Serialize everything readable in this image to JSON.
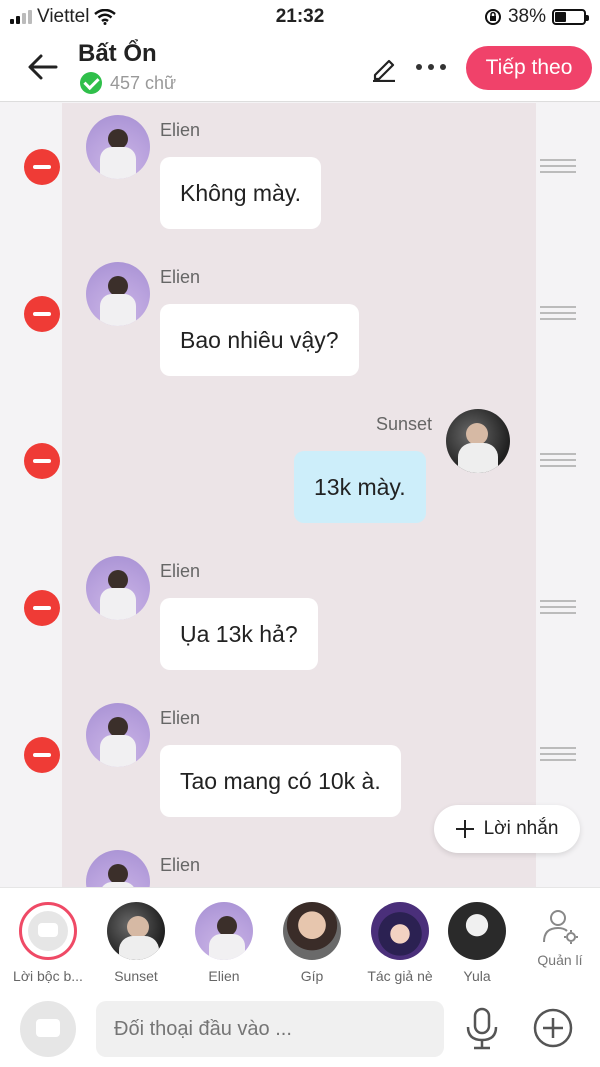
{
  "status": {
    "carrier": "Viettel",
    "time": "21:32",
    "battery": "38%",
    "battery_level": 0.38
  },
  "header": {
    "title": "Bất Ổn",
    "word_count": "457 chữ",
    "next_label": "Tiếp theo"
  },
  "messages": [
    {
      "name": "Elien",
      "text": "Không mày.",
      "side": "left"
    },
    {
      "name": "Elien",
      "text": "Bao nhiêu vậy?",
      "side": "left"
    },
    {
      "name": "Sunset",
      "text": "13k mày.",
      "side": "right"
    },
    {
      "name": "Elien",
      "text": "Ụa 13k hả?",
      "side": "left"
    },
    {
      "name": "Elien",
      "text": "Tao mang có 10k à.",
      "side": "left"
    },
    {
      "name": "Elien",
      "text": "",
      "side": "left"
    }
  ],
  "add_message_label": "Lời nhắn",
  "characters": [
    {
      "label": "Lời bộc b..."
    },
    {
      "label": "Sunset"
    },
    {
      "label": "Elien"
    },
    {
      "label": "Gíp"
    },
    {
      "label": "Tác giả nè"
    },
    {
      "label": "Yula"
    }
  ],
  "manage_label": "Quản lí",
  "input": {
    "placeholder": "Đối thoại đầu vào ..."
  },
  "icons": {
    "back": "arrow-left-icon",
    "edit": "pencil-icon",
    "more": "more-icon",
    "delete": "minus-circle-icon",
    "drag": "drag-handle-icon",
    "add": "plus-icon",
    "mic": "microphone-icon",
    "manage": "user-gear-icon"
  },
  "colors": {
    "accent": "#f0426a",
    "delete": "#ef3b36",
    "my_bubble": "#cdeefa",
    "chat_bg": "#ece4e7"
  }
}
